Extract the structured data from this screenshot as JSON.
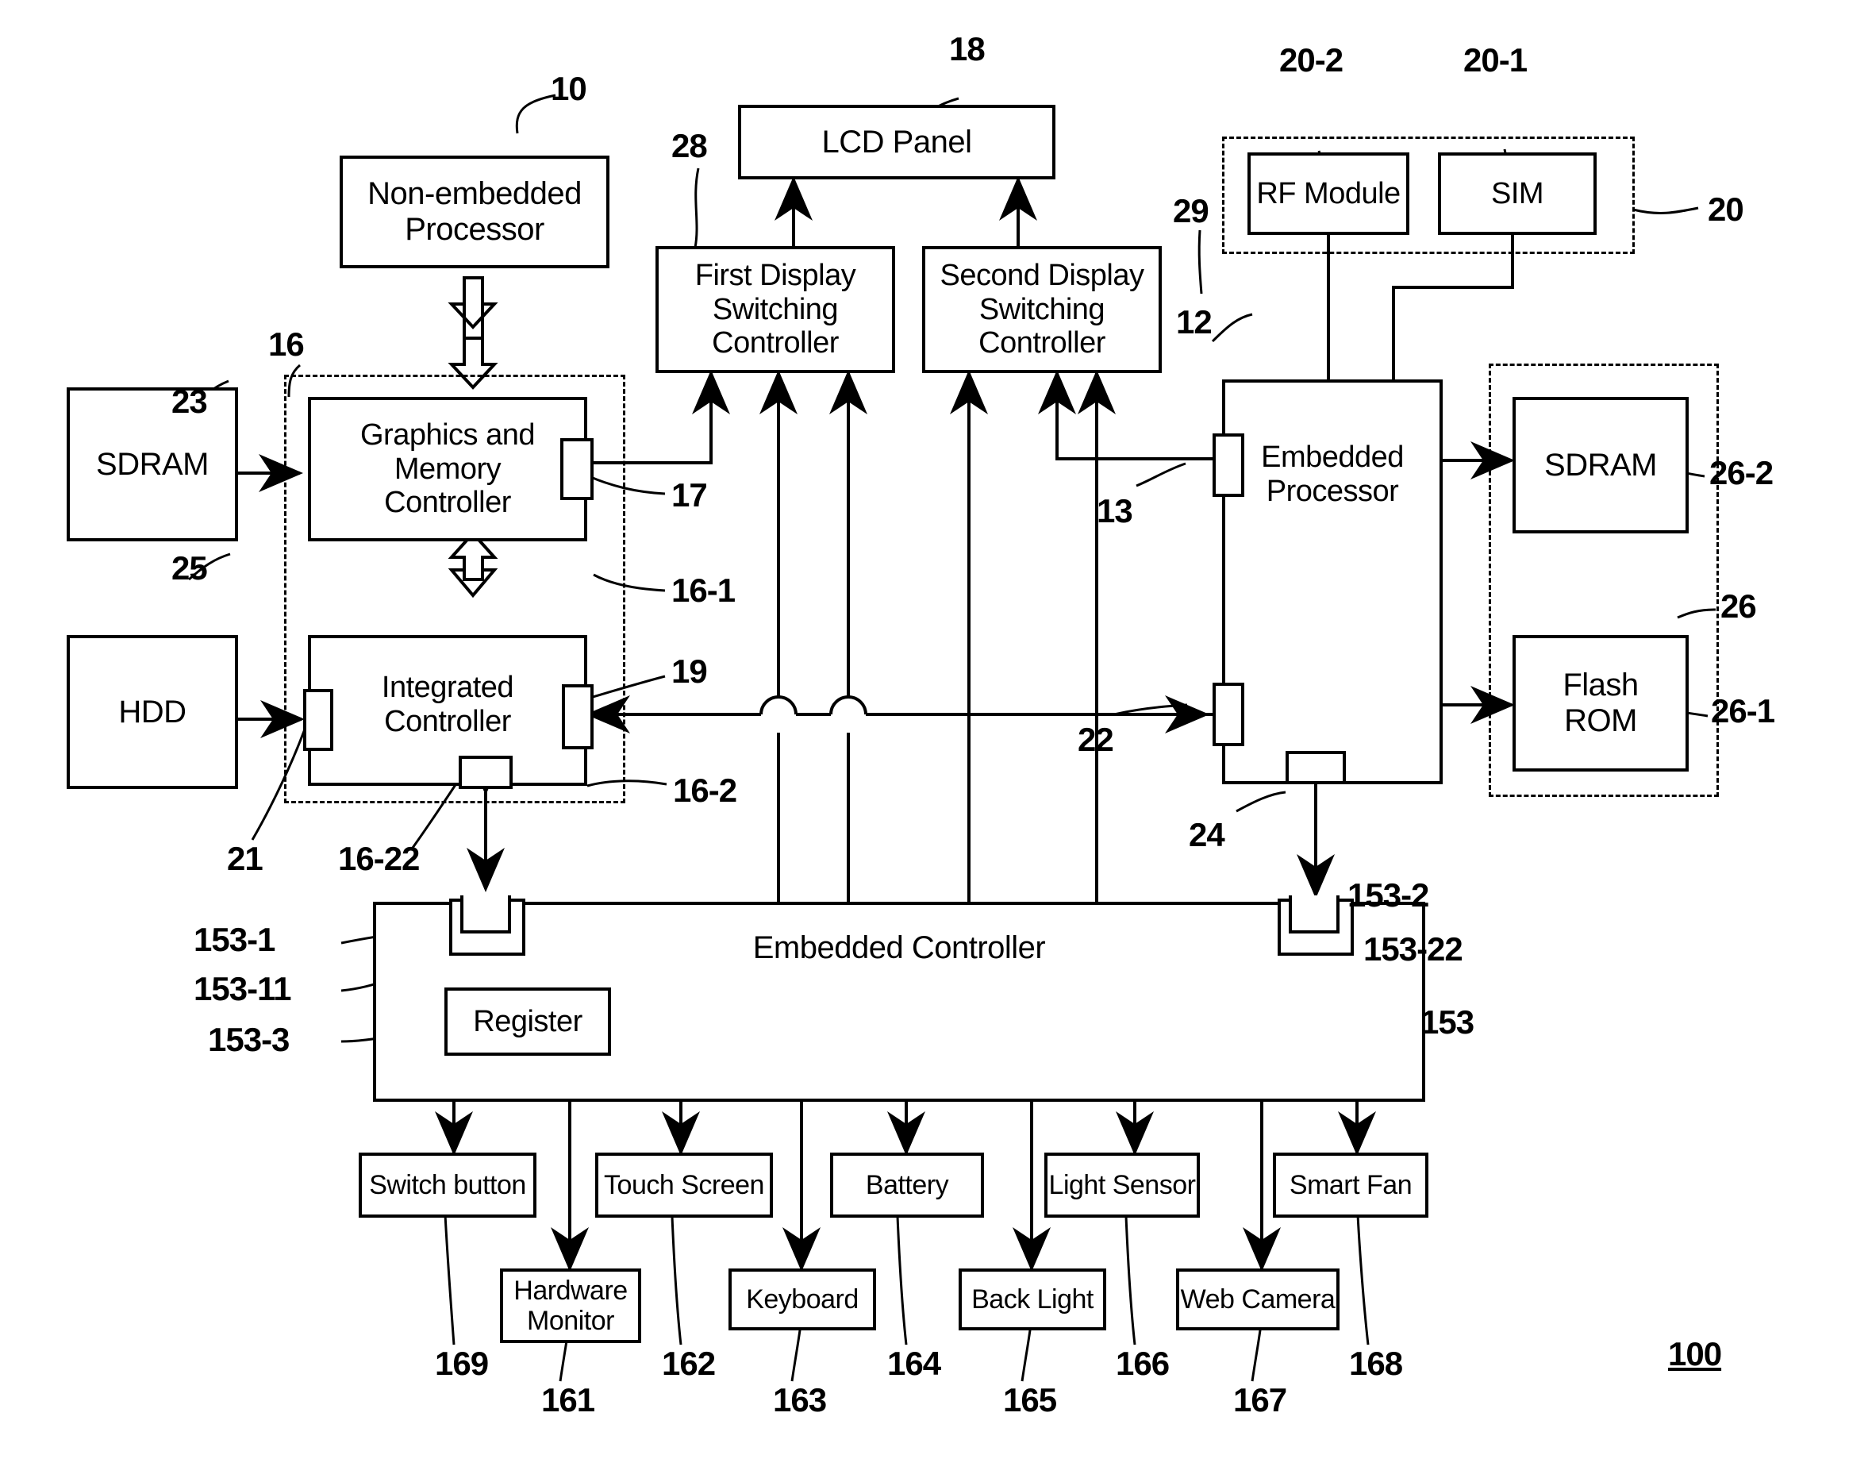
{
  "figure": {
    "id_label": "100",
    "title": "Computer system block diagram"
  },
  "blocks": {
    "non_embedded_processor": "Non-embedded\nProcessor",
    "non_embedded_processor_l1": "Non-embedded",
    "non_embedded_processor_l2": "Processor",
    "lcd_panel": "LCD Panel",
    "first_display_switching_controller_l1": "First Display",
    "first_display_switching_controller_l2": "Switching Controller",
    "second_display_switching_controller_l1": "Second Display",
    "second_display_switching_controller_l2": "Switching Controller",
    "rf_module": "RF Module",
    "sim": "SIM",
    "sdram_left": "SDRAM",
    "sdram_right": "SDRAM",
    "hdd": "HDD",
    "flash_rom_l1": "Flash",
    "flash_rom_l2": "ROM",
    "graphics_memory_controller_l1": "Graphics and",
    "graphics_memory_controller_l2": "Memory",
    "graphics_memory_controller_l3": "Controller",
    "integrated_controller_l1": "Integrated",
    "integrated_controller_l2": "Controller",
    "embedded_processor_l1": "Embedded",
    "embedded_processor_l2": "Processor",
    "embedded_controller": "Embedded Controller",
    "register": "Register",
    "switch_button": "Switch button",
    "touch_screen": "Touch Screen",
    "battery": "Battery",
    "light_sensor": "Light Sensor",
    "smart_fan": "Smart Fan",
    "hardware_monitor_l1": "Hardware",
    "hardware_monitor_l2": "Monitor",
    "keyboard": "Keyboard",
    "back_light": "Back Light",
    "web_camera": "Web Camera"
  },
  "refs": {
    "r10": "10",
    "r28": "28",
    "r18": "18",
    "r20": "20",
    "r20_1": "20-1",
    "r20_2": "20-2",
    "r29": "29",
    "r23": "23",
    "r16": "16",
    "r16_1": "16-1",
    "r16_2": "16-2",
    "r16_22": "16-22",
    "r17": "17",
    "r19": "19",
    "r21": "21",
    "r25": "25",
    "r12": "12",
    "r13": "13",
    "r22": "22",
    "r24": "24",
    "r26": "26",
    "r26_1": "26-1",
    "r26_2": "26-2",
    "r153": "153",
    "r153_1": "153-1",
    "r153_11": "153-11",
    "r153_2": "153-2",
    "r153_22": "153-22",
    "r153_3": "153-3",
    "r161": "161",
    "r162": "162",
    "r163": "163",
    "r164": "164",
    "r165": "165",
    "r166": "166",
    "r167": "167",
    "r168": "168",
    "r169": "169",
    "r100": "100"
  },
  "colors": {
    "stroke": "#000000",
    "background": "#ffffff"
  }
}
